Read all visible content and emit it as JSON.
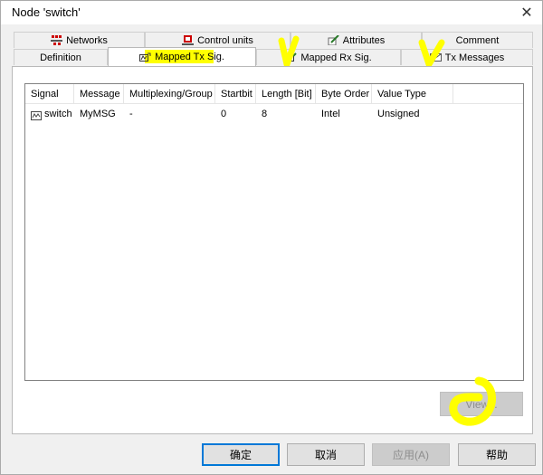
{
  "window": {
    "title": "Node 'switch'",
    "close_symbol": "✕"
  },
  "tabs_row1": [
    {
      "label": "Networks",
      "icon": "network-icon"
    },
    {
      "label": "Control units",
      "icon": "control-unit-icon"
    },
    {
      "label": "Attributes",
      "icon": "attributes-icon"
    },
    {
      "label": "Comment",
      "icon": ""
    }
  ],
  "tabs_row2": [
    {
      "label": "Definition",
      "icon": ""
    },
    {
      "label": "Mapped Tx Sig.",
      "icon": "tx-signal-icon",
      "active": true
    },
    {
      "label": "Mapped Rx Sig.",
      "icon": "rx-signal-icon"
    },
    {
      "label": "Tx Messages",
      "icon": "envelope-icon"
    }
  ],
  "table": {
    "columns": [
      "Signal",
      "Message",
      "Multiplexing/Group",
      "Startbit",
      "Length [Bit]",
      "Byte Order",
      "Value Type"
    ],
    "rows": [
      {
        "signal": "switch",
        "message": "MyMSG",
        "mux": "-",
        "startbit": "0",
        "length": "8",
        "byte_order": "Intel",
        "value_type": "Unsigned"
      }
    ]
  },
  "view_button": "View...",
  "footer": {
    "ok": "确定",
    "cancel": "取消",
    "apply": "应用(A)",
    "help": "帮助"
  },
  "colors": {
    "highlight": "#ffff00",
    "accent": "#0078d7"
  }
}
